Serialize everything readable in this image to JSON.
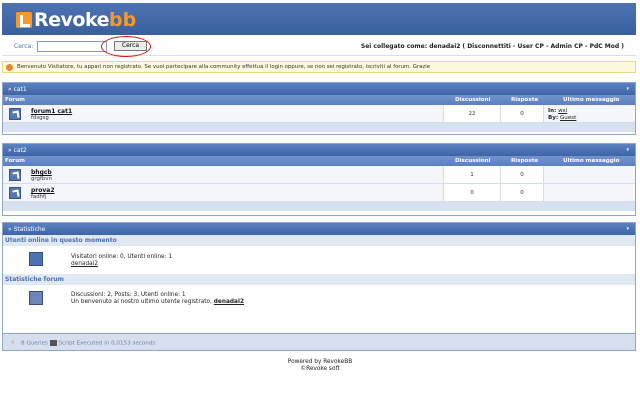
{
  "brand": {
    "name": "Revoke",
    "suffix": "bb"
  },
  "search": {
    "label": "Cerca:",
    "value": "",
    "button": "Cerca"
  },
  "user": {
    "prefix": "Sei collegato come: ",
    "name": "denadai2",
    "links": "( Disconnettiti - User CP - Admin CP - PdC Mod )"
  },
  "notice": "Benvenuto Visitatore, tu appari non registrato. Se vuoi partecipare alla community effettua il login oppure, se non sei registrato, iscriviti al forum. Grazie",
  "columns": {
    "forum": "Forum",
    "topics": "Discussioni",
    "replies": "Risposte",
    "last": "Ultimo messaggio"
  },
  "categories": [
    {
      "title": "» cat1",
      "forums": [
        {
          "name": "forum1 cat1",
          "desc": "fdsgsg",
          "topics": "22",
          "replies": "0",
          "last_in_label": "In:",
          "last_in": "wsi",
          "last_by_label": "By:",
          "last_by": "Guest"
        }
      ]
    },
    {
      "title": "» cat2",
      "forums": [
        {
          "name": "bhgcb",
          "desc": "grgfbvn",
          "topics": "1",
          "replies": "0"
        },
        {
          "name": "prova2",
          "desc": "fadhfj",
          "topics": "0",
          "replies": "0"
        }
      ]
    }
  ],
  "stats": {
    "title": "» Statistiche",
    "online_title": "Utenti online in questo momento",
    "online_line": "Visitatori online: 0, Utenti online: 1",
    "online_user": "denadai2",
    "forum_title": "Statistiche forum",
    "forum_line": "Discussioni: 2, Posts: 3, Utenti online: 1",
    "welcome_prefix": "Un benvenuto al nostro ultimo utente registrato, ",
    "welcome_user": "denadai2"
  },
  "footer": {
    "queries": "8 Queries",
    "executed": "Script Executed in 0,0153 seconds",
    "powered": "Powered by RevokeBB",
    "copyright": "©Revoke soft"
  }
}
